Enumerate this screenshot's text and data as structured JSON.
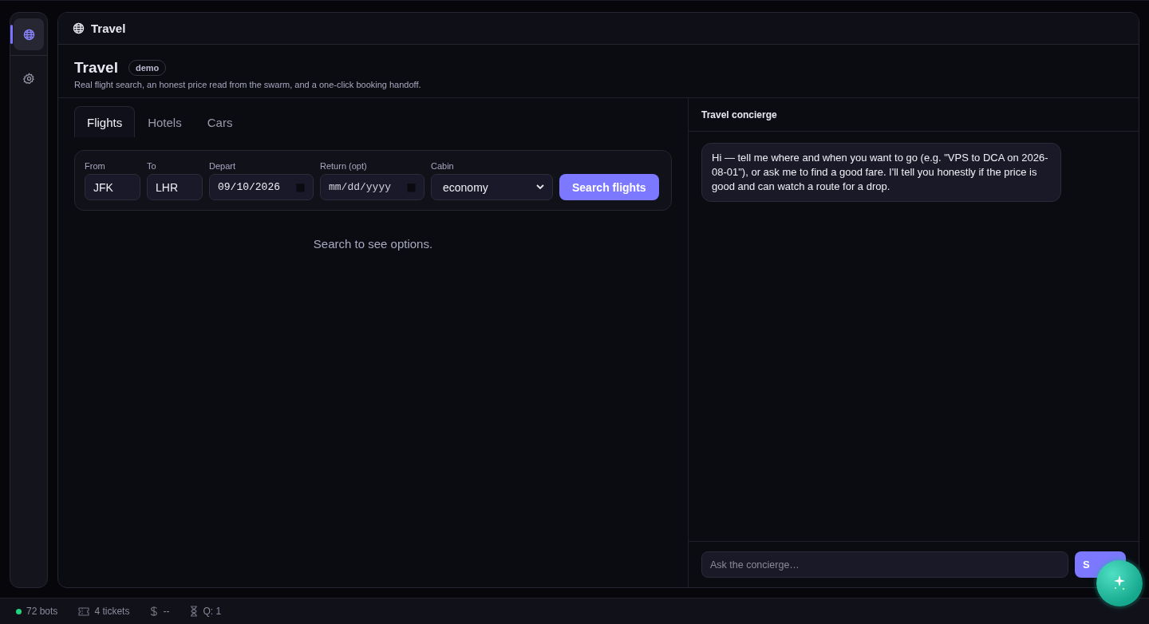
{
  "sidebar": {
    "items": [
      {
        "kind": "globe",
        "selected": true
      },
      {
        "kind": "gear",
        "selected": false
      }
    ]
  },
  "header": {
    "title": "Travel"
  },
  "page": {
    "title": "Travel",
    "badge": "demo",
    "subtitle": "Real flight search, an honest price read from the swarm, and a one-click booking handoff."
  },
  "tabs": [
    {
      "label": "Flights",
      "selected": true
    },
    {
      "label": "Hotels",
      "selected": false
    },
    {
      "label": "Cars",
      "selected": false
    }
  ],
  "search_form": {
    "fields": [
      {
        "kind": "text",
        "label": "From",
        "value": "JFK"
      },
      {
        "kind": "text",
        "label": "To",
        "value": "LHR"
      },
      {
        "kind": "date",
        "label": "Depart",
        "value": "09/10/2026"
      },
      {
        "kind": "date",
        "label": "Return (opt)",
        "placeholder": "mm/dd/yyyy"
      },
      {
        "kind": "select",
        "label": "Cabin",
        "value": "economy"
      }
    ],
    "button": "Search flights"
  },
  "empty_message": "Search to see options.",
  "concierge": {
    "title": "Travel concierge",
    "messages": [
      "Hi — tell me where and when you want to go (e.g. \"VPS to DCA on 2026-08-01\"), or ask me to find a good fare. I'll tell you honestly if the price is good and can watch a route for a drop."
    ],
    "input": {
      "placeholder": "Ask the concierge…"
    },
    "send_button": "S"
  },
  "status_bar": [
    {
      "kind": "dot",
      "label": "72 bots"
    },
    {
      "kind": "ticket",
      "label": "4 tickets"
    },
    {
      "kind": "dollar",
      "label": "--"
    },
    {
      "kind": "hourglass",
      "label": "Q: 1"
    }
  ]
}
